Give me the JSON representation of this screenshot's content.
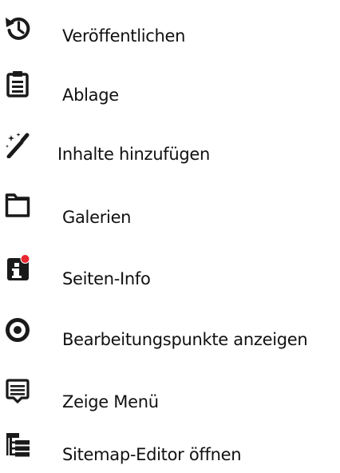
{
  "menu": {
    "items": [
      {
        "label": "Veröffentlichen",
        "icon": "history-icon"
      },
      {
        "label": "Ablage",
        "icon": "clipboard-icon"
      },
      {
        "label": "Inhalte hinzufügen",
        "icon": "magic-wand-icon"
      },
      {
        "label": "Galerien",
        "icon": "folder-icon"
      },
      {
        "label": "Seiten-Info",
        "icon": "info-notification-icon"
      },
      {
        "label": "Bearbeitungspunkte anzeigen",
        "icon": "target-icon"
      },
      {
        "label": "Zeige Menü",
        "icon": "menu-list-icon"
      },
      {
        "label": "Sitemap-Editor öffnen",
        "icon": "sitemap-icon"
      }
    ]
  },
  "colors": {
    "text": "#111111",
    "icon": "#1a1a1a",
    "notification_dot": "#e8272f"
  }
}
